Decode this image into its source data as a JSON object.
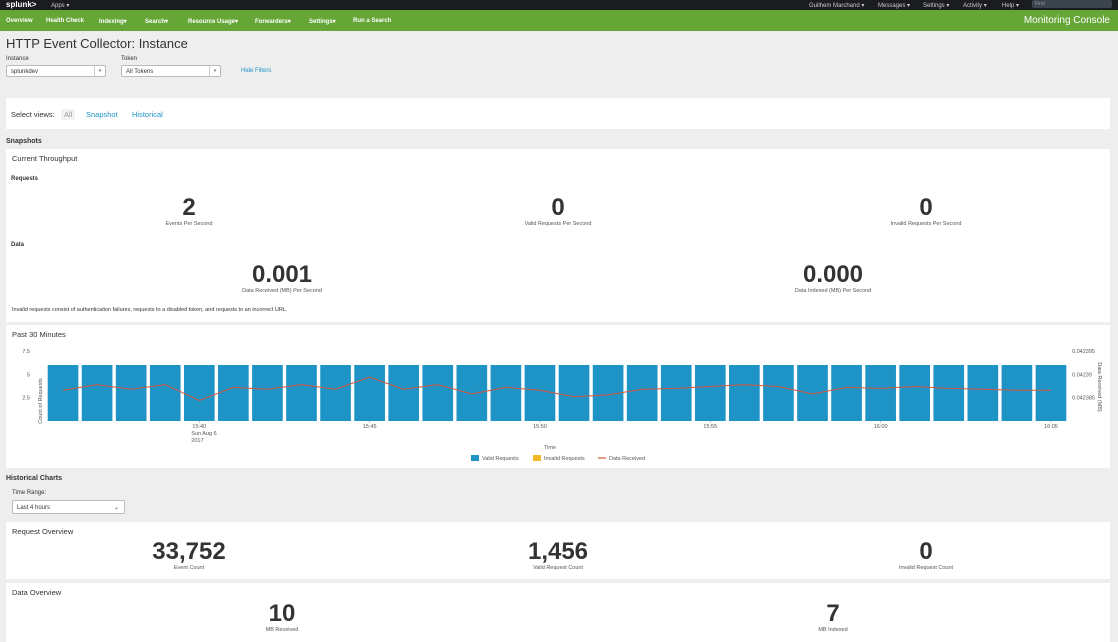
{
  "topbar": {
    "logo": "splunk>",
    "apps": "Apps",
    "user": "Guilhem Marchand",
    "messages": "Messages",
    "settings": "Settings",
    "activity": "Activity",
    "help": "Help",
    "find_placeholder": "Find"
  },
  "nav": {
    "items": [
      "Overview",
      "Health Check",
      "Indexing",
      "Search",
      "Resource Usage",
      "Forwarders",
      "Settings",
      "Run a Search"
    ],
    "app_title": "Monitoring Console"
  },
  "page": {
    "title": "HTTP Event Collector: Instance",
    "instance_label": "Instance",
    "instance_value": "splunkdev",
    "token_label": "Token",
    "token_value": "All Tokens",
    "hide_filters": "Hide Filters"
  },
  "views": {
    "label": "Select views:",
    "all": "All",
    "snapshot": "Snapshot",
    "historical": "Historical"
  },
  "snapshots": {
    "section": "Snapshots",
    "throughput_title": "Current Throughput",
    "requests_label": "Requests",
    "events_per_second": "2",
    "events_per_second_cap": "Events Per Second",
    "valid_per_second": "0",
    "valid_per_second_cap": "Valid Requests Per Second",
    "invalid_per_second": "0",
    "invalid_per_second_cap": "Invalid Requests Per Second",
    "data_label": "Data",
    "data_received": "0.001",
    "data_received_cap": "Data Received (MB) Per Second",
    "data_indexed": "0.000",
    "data_indexed_cap": "Data Indexed (MB) Per Second",
    "note": "Invalid requests consist of authentication failures, requests to a disabled token, and requests to an incorrect URL."
  },
  "chart_data": {
    "type": "bar",
    "title": "Past 30 Minutes",
    "xlabel": "Time",
    "ylabel": "Count of Requests",
    "y2label": "Data Received (MB)",
    "ylim": [
      0,
      7.5
    ],
    "y_ticks": [
      "7.5",
      "5",
      "2.5"
    ],
    "y2_ticks": [
      "0.042395",
      "0.04239",
      "0.042385"
    ],
    "x_ticks": [
      "15:40",
      "15:45",
      "15:50",
      "15:55",
      "16:00",
      "16:05"
    ],
    "x_date_lines": [
      "Sun Aug 6",
      "2017"
    ],
    "legend": [
      "Valid Requests",
      "Invalid Requests",
      "Data Received"
    ],
    "legend_placement": "bottom",
    "colors": {
      "valid": "#1e93c6",
      "invalid": "#f2b827",
      "data": "#d6563c"
    },
    "series": [
      {
        "name": "Valid Requests",
        "values": [
          6,
          6,
          6,
          6,
          6,
          6,
          6,
          6,
          6,
          6,
          6,
          6,
          6,
          6,
          6,
          6,
          6,
          6,
          6,
          6,
          6,
          6,
          6,
          6,
          6,
          6,
          6,
          6,
          6,
          6
        ]
      },
      {
        "name": "Invalid Requests",
        "values": [
          0,
          0,
          0,
          0,
          0,
          0,
          0,
          0,
          0,
          0,
          0,
          0,
          0,
          0,
          0,
          0,
          0,
          0,
          0,
          0,
          0,
          0,
          0,
          0,
          0,
          0,
          0,
          0,
          0,
          0
        ]
      },
      {
        "name": "Data Received",
        "values": [
          3.3,
          3.9,
          3.4,
          3.9,
          2.2,
          3.6,
          3.4,
          3.9,
          3.4,
          4.7,
          3.4,
          3.9,
          2.9,
          3.6,
          3.3,
          2.6,
          2.8,
          3.4,
          3.5,
          3.7,
          3.9,
          3.7,
          2.9,
          3.6,
          3.5,
          3.7,
          3.5,
          3.4,
          3.3,
          3.3
        ]
      }
    ]
  },
  "historical": {
    "section": "Historical Charts",
    "time_range_label": "Time Range:",
    "time_range_value": "Last 4 hours",
    "request_overview_title": "Request Overview",
    "event_count": "33,752",
    "event_count_cap": "Event Count",
    "valid_request_count": "1,456",
    "valid_request_count_cap": "Valid Request Count",
    "invalid_request_count": "0",
    "invalid_request_count_cap": "Invalid Request Count",
    "data_overview_title": "Data Overview",
    "mb_received": "10",
    "mb_received_cap": "MB Received",
    "mb_indexed": "7",
    "mb_indexed_cap": "MB Indexed"
  }
}
